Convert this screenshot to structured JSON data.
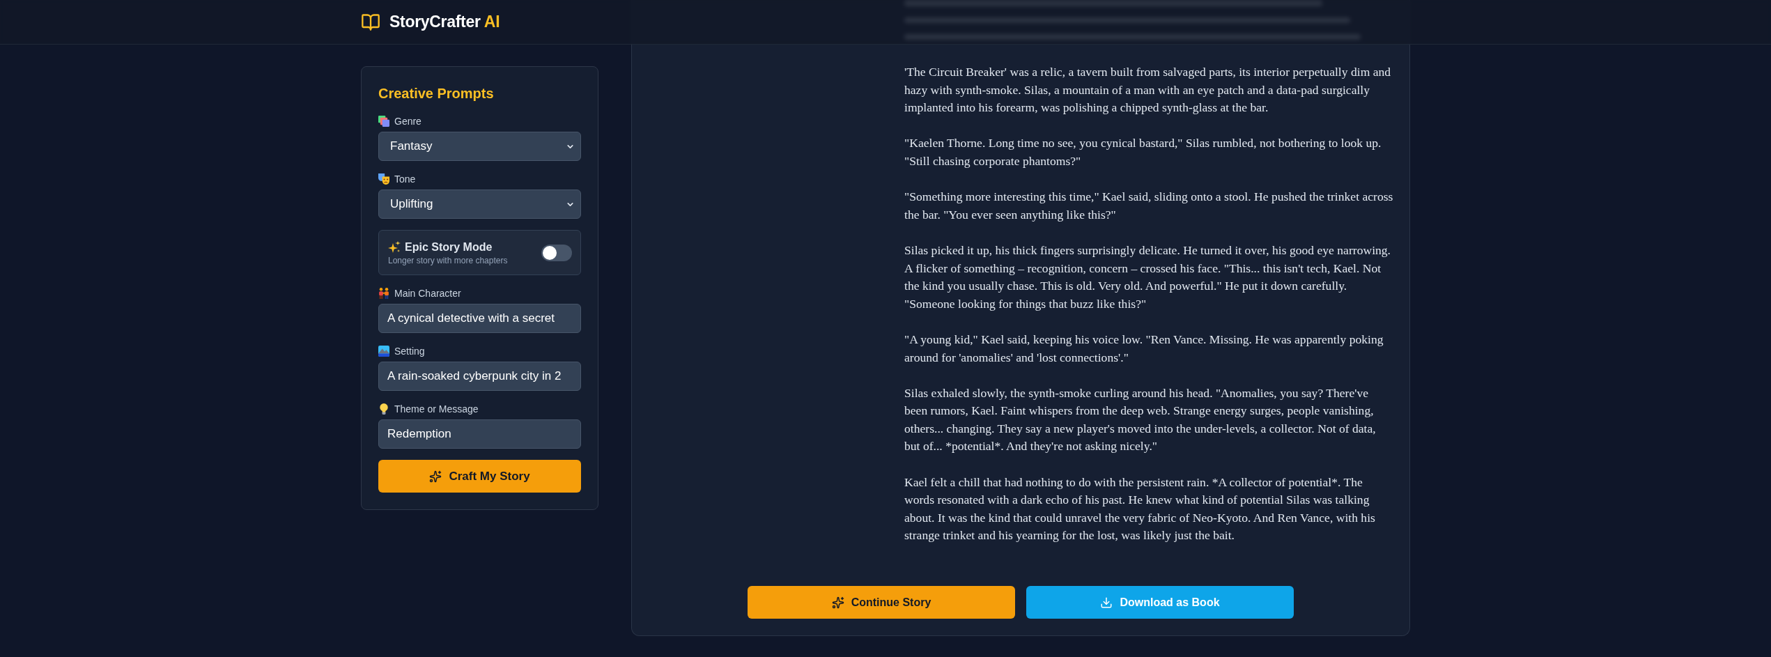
{
  "header": {
    "logo": {
      "name": "StoryCrafter",
      "accent": "AI"
    }
  },
  "prompts_panel": {
    "title": "Creative Prompts",
    "fields": [
      {
        "kind": "select",
        "label": "Genre",
        "value": "Fantasy"
      },
      {
        "kind": "select",
        "label": "Tone",
        "value": "Uplifting"
      },
      {
        "kind": "toggle",
        "label": "Epic Story Mode",
        "description": "Longer story with more chapters",
        "on": false
      },
      {
        "kind": "input",
        "label": "Main Character",
        "value": "A cynical detective with a secret"
      },
      {
        "kind": "input",
        "label": "Setting",
        "value": "A rain-soaked cyberpunk city in 2"
      },
      {
        "kind": "input",
        "label": "Theme or Message",
        "value": "Redemption"
      }
    ],
    "submit_button": "Craft My Story"
  },
  "story": {
    "paragraphs": [
      "'The Circuit Breaker' was a relic, a tavern built from salvaged parts, its interior perpetually dim and hazy with synth-smoke. Silas, a mountain of a man with an eye patch and a data-pad surgically implanted into his forearm, was polishing a chipped synth-glass at the bar.",
      "\"Kaelen Thorne. Long time no see, you cynical bastard,\" Silas rumbled, not bothering to look up. \"Still chasing corporate phantoms?\"",
      "\"Something more interesting this time,\" Kael said, sliding onto a stool. He pushed the trinket across the bar. \"You ever seen anything like this?\"",
      "Silas picked it up, his thick fingers surprisingly delicate. He turned it over, his good eye narrowing. A flicker of something – recognition, concern – crossed his face. \"This... this isn't tech, Kael. Not the kind you usually chase. This is old. Very old. And powerful.\" He put it down carefully. \"Someone looking for things that buzz like this?\"",
      "\"A young kid,\" Kael said, keeping his voice low. \"Ren Vance. Missing. He was apparently poking around for 'anomalies' and 'lost connections'.\"",
      "Silas exhaled slowly, the synth-smoke curling around his head. \"Anomalies, you say? There've been rumors, Kael. Faint whispers from the deep web. Strange energy surges, people vanishing, others... changing. They say a new player's moved into the under-levels, a collector. Not of data, but of... *potential*. And they're not asking nicely.\"",
      "Kael felt a chill that had nothing to do with the persistent rain. *A collector of potential*. The words resonated with a dark echo of his past. He knew what kind of potential Silas was talking about. It was the kind that could unravel the very fabric of Neo-Kyoto. And Ren Vance, with his strange trinket and his yearning for the lost, was likely just the bait."
    ]
  },
  "actions": [
    {
      "kind": "continue",
      "label": "Continue Story"
    },
    {
      "kind": "download",
      "label": "Download as Book"
    }
  ]
}
